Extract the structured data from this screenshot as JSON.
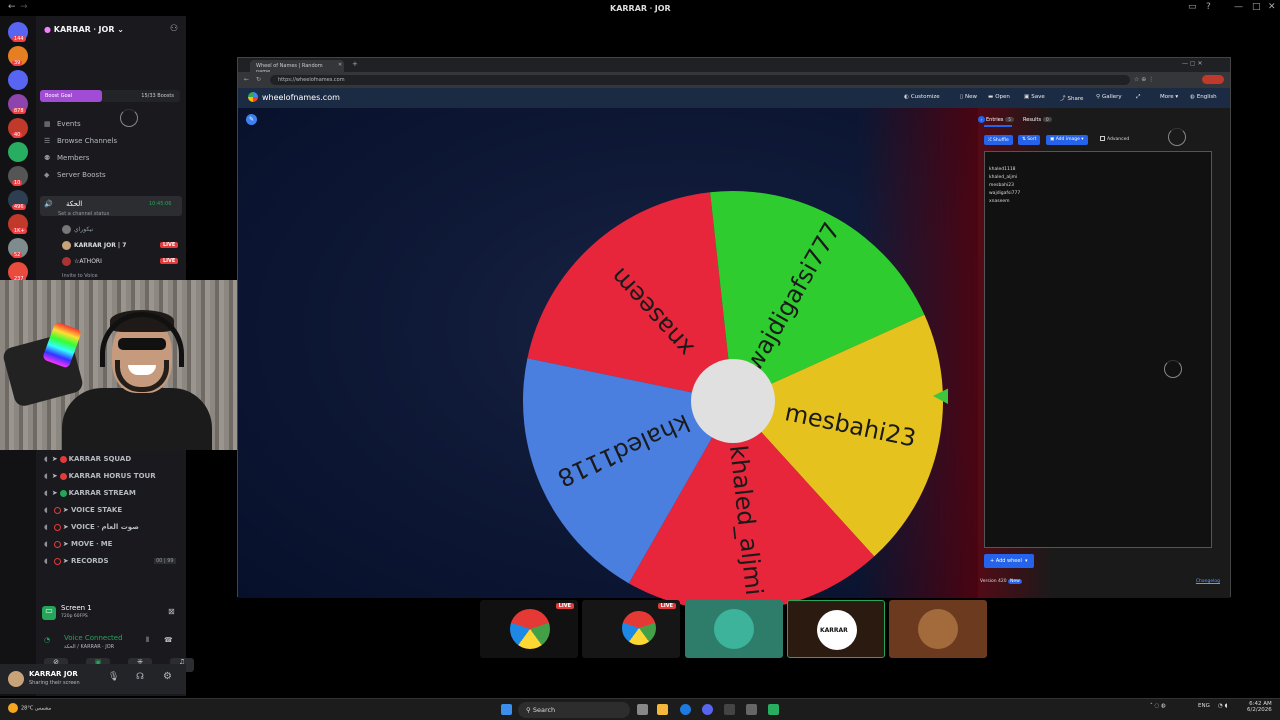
{
  "window": {
    "title": "KARRAR ⸱ JOR"
  },
  "server_rail": [
    {
      "color": "#5865f2",
      "badge": "144"
    },
    {
      "color": "#e67e22",
      "badge": "39"
    },
    {
      "color": "#5865f2",
      "badge": ""
    },
    {
      "color": "#8e44ad",
      "badge": "878"
    },
    {
      "color": "#c0392b",
      "badge": "40"
    },
    {
      "color": "#27ae60",
      "badge": ""
    },
    {
      "color": "#555555",
      "badge": "10"
    },
    {
      "color": "#2c3e50",
      "badge": "496"
    },
    {
      "color": "#c0392b",
      "badge": "1K+"
    },
    {
      "color": "#7f8c8d",
      "badge": "52"
    },
    {
      "color": "#e74c3c",
      "badge": "237"
    },
    {
      "color": "#16a085",
      "badge": "444"
    },
    {
      "color": "#d35400",
      "badge": "NEW"
    }
  ],
  "guild": {
    "name": "KARRAR ⸱ JOR",
    "boost_goal": "Boost Goal",
    "boost_count": "15/33 Boosts",
    "nav": [
      "Events",
      "Browse Channels",
      "Members",
      "Server Boosts"
    ]
  },
  "active_voice": {
    "name": "الحكة",
    "time": "10:45:06",
    "status": "Set a channel status",
    "users": [
      {
        "name": "نيكوراي",
        "live": false
      },
      {
        "name": "KARRAR JOR | 7",
        "live": true
      },
      {
        "name": "☆ATHORI",
        "live": true
      }
    ],
    "invite": "Invite to Voice",
    "live_label": "LIVE"
  },
  "voice_channels": [
    "KARRAR SQUAD",
    "KARRAR HORUS TOUR",
    "KARRAR STREAM",
    "VOICE STAKE",
    "VOICE ⸱ صوت العام",
    "MOVE ⸱ ME",
    "RECORDS"
  ],
  "records_count": "00 | 99",
  "screen_share": {
    "title": "Screen 1",
    "quality": "720p 60FPS"
  },
  "voice_panel": {
    "status": "Voice Connected",
    "channel": "الحكة / KARRAR ⸱ JOR"
  },
  "user_panel": {
    "name": "KARRAR JOR",
    "status": "Sharing their screen"
  },
  "browser": {
    "tab_title": "Wheel of Names | Random name",
    "url": "https://wheelofnames.com",
    "site": "wheelofnames.com",
    "menu": [
      "Customize",
      "New",
      "Open",
      "Save",
      "Share",
      "Gallery",
      "",
      "More",
      "English"
    ]
  },
  "wheel": {
    "entries": [
      "xnaseem",
      "wajdigafsi777",
      "mesbahi23",
      "khaled_aljmi",
      "khaled1118"
    ],
    "colors": [
      "#e8263b",
      "#2ecc2e",
      "#e6c21f",
      "#e8263b",
      "#4a7fe0"
    ]
  },
  "entries_panel": {
    "tab_entries": "Entries",
    "entries_count": "5",
    "tab_results": "Results",
    "results_count": "0",
    "shuffle": "Shuffle",
    "sort": "Sort",
    "add_image": "Add image",
    "advanced": "Advanced",
    "lines": [
      "khaled1118",
      "khaled_aljmi",
      "mesbahi23",
      "wajdigafsi777",
      "xnaseem"
    ],
    "add_wheel": "Add wheel",
    "version": "Version 420",
    "version_tag": "New",
    "changelog": "Changelog"
  },
  "share_tiles": {
    "live_label": "LIVE",
    "avatar_text": "KARRAR"
  },
  "taskbar": {
    "weather": "28°C",
    "weather_desc": "مشمس",
    "search": "Search",
    "lang": "ENG",
    "time": "6:42 AM",
    "date": "6/2/2026"
  }
}
